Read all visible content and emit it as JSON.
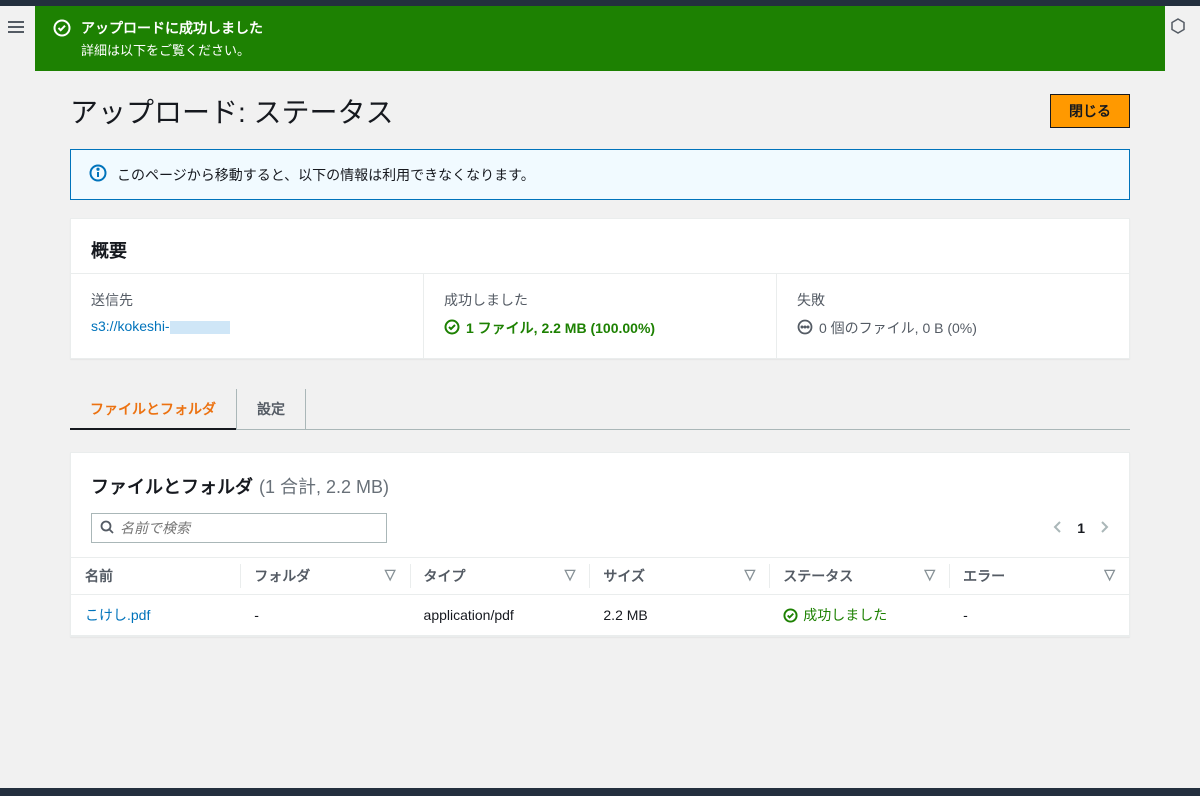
{
  "flash": {
    "title": "アップロードに成功しました",
    "subtitle": "詳細は以下をご覧ください。"
  },
  "page": {
    "title": "アップロード: ステータス",
    "close_button": "閉じる"
  },
  "info_alert": "このページから移動すると、以下の情報は利用できなくなります。",
  "summary": {
    "heading": "概要",
    "destination_label": "送信先",
    "destination_value": "s3://kokeshi-",
    "success_label": "成功しました",
    "success_value": "1 ファイル, 2.2 MB (100.00%)",
    "fail_label": "失敗",
    "fail_value": "0 個のファイル, 0 B (0%)"
  },
  "tabs": {
    "files": "ファイルとフォルダ",
    "settings": "設定"
  },
  "table": {
    "title": "ファイルとフォルダ",
    "count": "(1 合計, 2.2 MB)",
    "search_placeholder": "名前で検索",
    "page_num": "1",
    "columns": {
      "name": "名前",
      "folder": "フォルダ",
      "type": "タイプ",
      "size": "サイズ",
      "status": "ステータス",
      "error": "エラー"
    },
    "rows": [
      {
        "name": "こけし.pdf",
        "folder": "-",
        "type": "application/pdf",
        "size": "2.2 MB",
        "status": "成功しました",
        "error": "-"
      }
    ]
  }
}
